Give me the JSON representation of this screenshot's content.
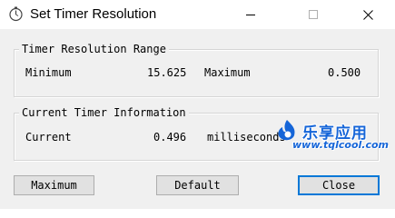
{
  "window": {
    "title": "Set Timer Resolution"
  },
  "range_group": {
    "label": "Timer Resolution Range",
    "minimum_label": "Minimum",
    "minimum_value": "15.625",
    "maximum_label": "Maximum",
    "maximum_value": "0.500"
  },
  "current_group": {
    "label": "Current Timer Information",
    "current_label": "Current",
    "current_value": "0.496",
    "unit_label": "milliseconds"
  },
  "buttons": {
    "maximum_label": "Maximum",
    "default_label": "Default",
    "close_label": "Close"
  },
  "watermark": {
    "brand_cn": "乐享应用",
    "url": "www.tqlcool.com"
  },
  "icons": {
    "app": "stopwatch-icon",
    "minimize": "minimize-icon",
    "maximize": "maximize-icon",
    "close": "close-icon",
    "watermark_logo": "flame-logo-icon"
  },
  "colors": {
    "default_button_border": "#0078d7",
    "watermark_blue": "#1565d8"
  }
}
